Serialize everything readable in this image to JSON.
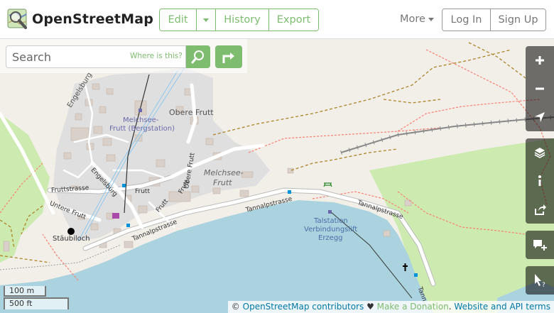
{
  "header": {
    "brand": "OpenStreetMap",
    "edit_label": "Edit",
    "history_label": "History",
    "export_label": "Export",
    "more_label": "More",
    "login_label": "Log In",
    "signup_label": "Sign Up",
    "accent_color": "#7ebc6f"
  },
  "search": {
    "placeholder": "Search",
    "where_label": "Where is this?"
  },
  "map_labels": {
    "engelsburg_top": "Engelsburg",
    "melchsee_bergstation_1": "Melchsee-",
    "melchsee_bergstation_2": "Frutt (Bergstation)",
    "obere_frutt": "Obere Frutt",
    "obere_frutt_road": "Obere Frutt",
    "melchsee_frutt_1": "Melchsee-",
    "melchsee_frutt_2": "Frutt",
    "fruttstrasse": "Fruttstrasse",
    "engelsburg_road": "Engelsburg",
    "frutt_1": "Frutt",
    "frutt_2": "Frutt",
    "frutt_3": "Frutt",
    "untere_frutt": "Untere Frutt",
    "tannalpstrasse_1": "Tannalpstrasse",
    "tannalpstrasse_2": "Tannalpstrasse",
    "tannalpstrasse_3": "Tannalpstrasse",
    "tannalpstrasse_4": "Tann...",
    "staubiloch": "Stäubiloch",
    "talstation_1": "Talstation",
    "talstation_2": "Verbindungslift",
    "talstation_3": "Erzegg"
  },
  "scale": {
    "metric": "100 m",
    "imperial": "500 ft"
  },
  "attribution": {
    "copyright": "© ",
    "contributors": "OpenStreetMap contributors",
    "heart": " ♥ ",
    "donation": "Make a Donation",
    "sep": ". ",
    "terms": "Website and API terms"
  },
  "controls": {
    "zoom_in": "zoom-in",
    "zoom_out": "zoom-out",
    "locate": "locate",
    "layers": "layers",
    "info": "info",
    "share": "share",
    "note": "add-note",
    "query": "query-features"
  },
  "colors": {
    "lake": "#aad3df",
    "meadow": "#cdebb0",
    "residential": "#e0dfdf",
    "building": "#d9d0c9",
    "track": "#ac8327",
    "path": "#fa8072"
  }
}
